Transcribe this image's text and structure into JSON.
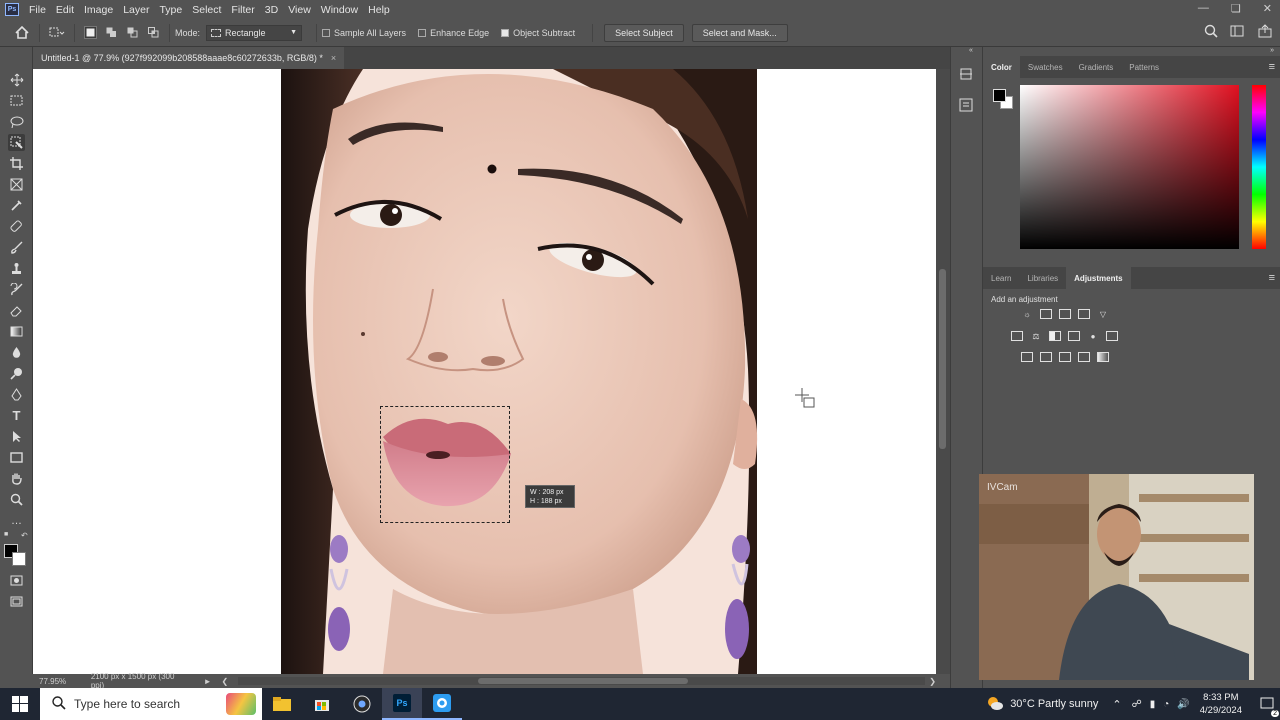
{
  "menu": {
    "logo": "Ps",
    "items": [
      "File",
      "Edit",
      "Image",
      "Layer",
      "Type",
      "Select",
      "Filter",
      "3D",
      "View",
      "Window",
      "Help"
    ]
  },
  "options": {
    "mode_label": "Mode:",
    "mode_value": "Rectangle",
    "sample_all_layers": "Sample All Layers",
    "enhance_edge": "Enhance Edge",
    "object_subtract": "Object Subtract",
    "select_subject": "Select Subject",
    "select_and_mask": "Select and Mask..."
  },
  "document": {
    "tab_title": "Untitled-1 @ 77.9% (927f992099b208588aaae8c60272633b, RGB/8) *",
    "selection_w": "W : 208 px",
    "selection_h": "H : 188 px"
  },
  "status": {
    "zoom": "77.95%",
    "doc_info": "2100 px x 1500 px (300 ppi)"
  },
  "panels": {
    "color_tabs": [
      "Color",
      "Swatches",
      "Gradients",
      "Patterns"
    ],
    "color_active": "Color",
    "adj_tabs": [
      "Learn",
      "Libraries",
      "Adjustments"
    ],
    "adj_active": "Adjustments",
    "add_adjustment": "Add an adjustment"
  },
  "webcam": {
    "watermark": "IVCam"
  },
  "taskbar": {
    "search_placeholder": "Type here to search",
    "weather": "30°C  Partly sunny",
    "time": "8:33 PM",
    "date": "4/29/2024",
    "notif_count": "2"
  },
  "colors": {
    "ps_bg": "#535353",
    "accent_red": "#e01020",
    "taskbar": "#1f2633"
  }
}
